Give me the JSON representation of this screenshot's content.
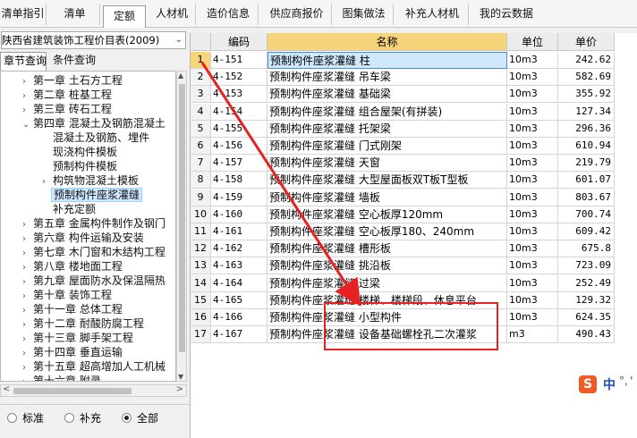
{
  "tabs": [
    "清单指引",
    "清单",
    "定额",
    "人材机",
    "造价信息",
    "供应商报价",
    "图集做法",
    "补充人材机",
    "我的云数据"
  ],
  "left": {
    "library": "陕西省建筑装饰工程价目表(2009)",
    "subtabs": [
      "章节查询",
      "条件查询"
    ],
    "tree": [
      "第一章 土石方工程",
      "第二章 桩基工程",
      "第三章 砖石工程",
      "第四章 混凝土及钢筋混凝土",
      "混凝土及钢筋、埋件",
      "现浇构件模板",
      "预制构件模板",
      "构筑物混凝土模板",
      "预制构件座浆灌缝",
      "补充定额",
      "第五章 金属构件制作及钢门",
      "第六章 构件运输及安装",
      "第七章 木门窗和木结构工程",
      "第八章 楼地面工程",
      "第九章 屋面防水及保温隔热",
      "第十章 装饰工程",
      "第十一章 总体工程",
      "第十二章 耐酸防腐工程",
      "第十三章 脚手架工程",
      "第十四章 垂直运输",
      "第十五章 超高增加人工机械",
      "第十六章 附录"
    ],
    "radios": [
      "标准",
      "补充",
      "全部"
    ]
  },
  "grid": {
    "columns": [
      "编码",
      "名称",
      "单位",
      "单价"
    ],
    "rows": [
      [
        "1",
        "4-151",
        "预制构件座浆灌缝 柱",
        "10m3",
        "242.62"
      ],
      [
        "2",
        "4-152",
        "预制构件座浆灌缝 吊车梁",
        "10m3",
        "582.69"
      ],
      [
        "3",
        "4-153",
        "预制构件座浆灌缝 基础梁",
        "10m3",
        "355.92"
      ],
      [
        "4",
        "4-154",
        "预制构件座浆灌缝 组合屋架(有拼装)",
        "10m3",
        "127.34"
      ],
      [
        "5",
        "4-155",
        "预制构件座浆灌缝 托架梁",
        "10m3",
        "296.36"
      ],
      [
        "6",
        "4-156",
        "预制构件座浆灌缝 门式刚架",
        "10m3",
        "610.94"
      ],
      [
        "7",
        "4-157",
        "预制构件座浆灌缝 天窗",
        "10m3",
        "219.79"
      ],
      [
        "8",
        "4-158",
        "预制构件座浆灌缝 大型屋面板双T板T型板",
        "10m3",
        "601.07"
      ],
      [
        "9",
        "4-159",
        "预制构件座浆灌缝 墙板",
        "10m3",
        "803.67"
      ],
      [
        "10",
        "4-160",
        "预制构件座浆灌缝 空心板厚120mm",
        "10m3",
        "700.74"
      ],
      [
        "11",
        "4-161",
        "预制构件座浆灌缝 空心板厚180、240mm",
        "10m3",
        "609.42"
      ],
      [
        "12",
        "4-162",
        "预制构件座浆灌缝 槽形板",
        "10m3",
        "675.8"
      ],
      [
        "13",
        "4-163",
        "预制构件座浆灌缝 挑沿板",
        "10m3",
        "723.09"
      ],
      [
        "14",
        "4-164",
        "预制构件座浆灌缝 过梁",
        "10m3",
        "252.49"
      ],
      [
        "15",
        "4-165",
        "预制构件座浆灌缝 楼梯、楼梯段、休息平台",
        "10m3",
        "129.32"
      ],
      [
        "16",
        "4-166",
        "预制构件座浆灌缝 小型构件",
        "10m3",
        "624.35"
      ],
      [
        "17",
        "4-167",
        "预制构件座浆灌缝 设备基础螺栓孔二次灌浆",
        "m3",
        "490.43"
      ]
    ]
  },
  "ime": {
    "logo": "S",
    "lang": "中",
    "punct": "°,",
    "extra": "'"
  },
  "colors": {
    "header_highlight": "#f5d47a",
    "annotation": "#e62222",
    "selection": "#cde8ff"
  }
}
